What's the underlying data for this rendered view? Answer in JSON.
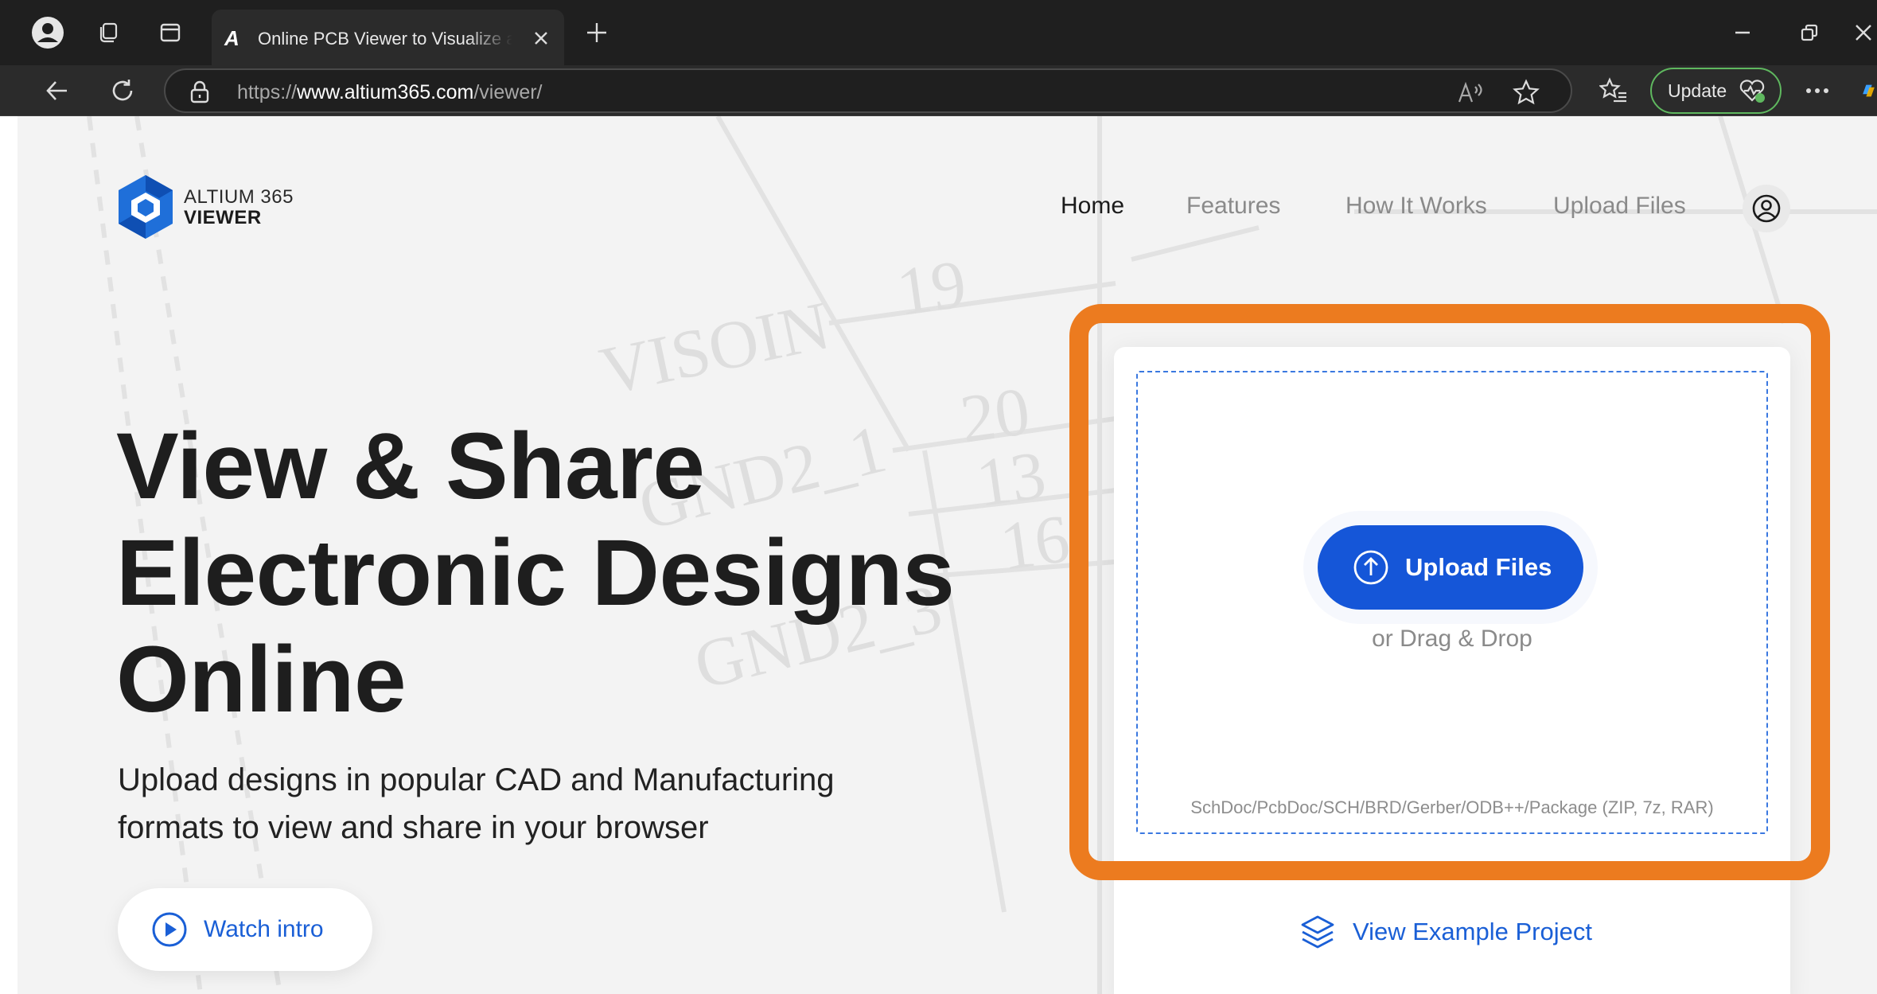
{
  "browser": {
    "tab": {
      "favicon_letter": "A",
      "title": "Online PCB Viewer to Visualize and Share Electronic Designs"
    },
    "address": {
      "scheme": "https://",
      "host": "www.altium365.com",
      "path": "/viewer/"
    },
    "update_label": "Update",
    "icons": {
      "profile": "profile-icon",
      "workspaces": "workspaces-icon",
      "tab_actions": "tab-actions-icon",
      "close_tab": "close-icon",
      "new_tab": "plus-icon",
      "minimize": "minimize-icon",
      "restore": "restore-icon",
      "back": "back-arrow-icon",
      "refresh": "refresh-icon",
      "lock": "lock-icon",
      "read_aloud": "read-aloud-icon",
      "favorite": "star-icon",
      "favorites_list": "favorites-list-icon",
      "more": "more-icon",
      "copilot": "copilot-icon"
    }
  },
  "brand": {
    "logo_top": "ALTIUM 365",
    "logo_bottom": "VIEWER",
    "color_primary": "#1556d8",
    "color_logo": "#1f6fd9",
    "color_highlight": "#ec7b1f"
  },
  "nav": {
    "items": [
      {
        "label": "Home",
        "active": true
      },
      {
        "label": "Features",
        "active": false
      },
      {
        "label": "How It Works",
        "active": false
      },
      {
        "label": "Upload Files",
        "active": false
      }
    ],
    "account_icon": "user-circle-icon"
  },
  "hero": {
    "title_lines": [
      "View & Share",
      "Electronic Designs",
      "Online"
    ],
    "subtitle_lines": [
      "Upload designs in popular CAD and Manufacturing",
      "formats to view and share in your browser"
    ],
    "watch_label": "Watch intro",
    "watch_icon": "play-circle-icon"
  },
  "upload": {
    "button_label": "Upload Files",
    "button_icon": "upload-arrow-icon",
    "drag_text": "or Drag & Drop",
    "formats": "SchDoc/PcbDoc/SCH/BRD/Gerber/ODB++/Package (ZIP, 7z, RAR)",
    "example_label": "View Example Project",
    "example_icon": "layers-icon"
  },
  "background_schematic": {
    "labels": [
      "VISOIN",
      "GND2_1",
      "GND2_3",
      "19",
      "20",
      "13",
      "16"
    ]
  }
}
